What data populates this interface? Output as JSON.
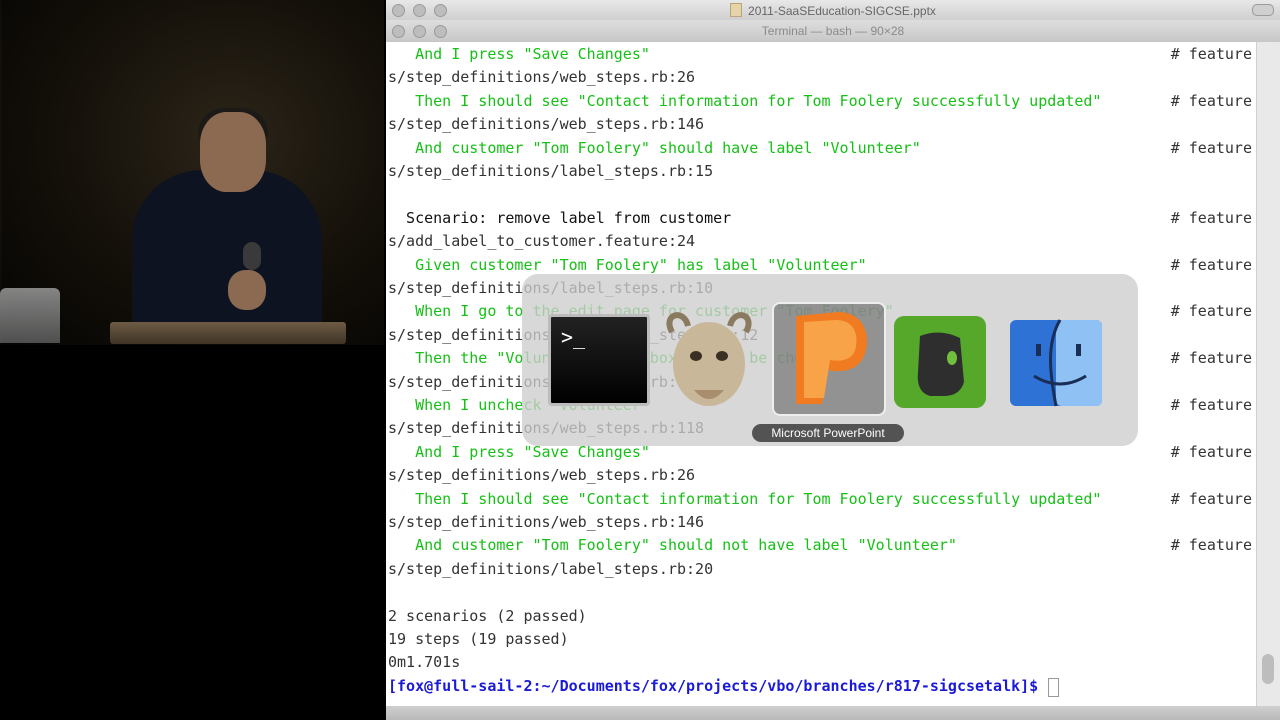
{
  "window": {
    "title": "2011-SaaSEducation-SIGCSE.pptx",
    "terminal_title": "Terminal — bash — 90×28"
  },
  "terminal_lines": [
    {
      "text": "   And I press \"Save Changes\"",
      "comment": "# feature",
      "style": "green"
    },
    {
      "text": "s/step_definitions/web_steps.rb:26",
      "comment": "",
      "style": "plain"
    },
    {
      "text": "   Then I should see \"Contact information for Tom Foolery successfully updated\"",
      "comment": "# feature",
      "style": "green"
    },
    {
      "text": "s/step_definitions/web_steps.rb:146",
      "comment": "",
      "style": "plain"
    },
    {
      "text": "   And customer \"Tom Foolery\" should have label \"Volunteer\"",
      "comment": "# feature",
      "style": "green"
    },
    {
      "text": "s/step_definitions/label_steps.rb:15",
      "comment": "",
      "style": "plain"
    },
    {
      "text": "",
      "comment": "",
      "style": "plain"
    },
    {
      "text": "  Scenario: remove label from customer",
      "comment": "# feature",
      "style": "black"
    },
    {
      "text": "s/add_label_to_customer.feature:24",
      "comment": "",
      "style": "plain"
    },
    {
      "text": "   Given customer \"Tom Foolery\" has label \"Volunteer\"",
      "comment": "# feature",
      "style": "green"
    },
    {
      "text": "s/step_definitions/label_steps.rb:10",
      "comment": "",
      "style": "plain"
    },
    {
      "text": "   When I go to the edit page for customer \"Tom Foolery\"",
      "comment": "# feature",
      "style": "green"
    },
    {
      "text": "s/step_definitions/navigation_steps.rb:12",
      "comment": "",
      "style": "plain"
    },
    {
      "text": "   Then the \"Volunteer\" checkbox should be checked",
      "comment": "# feature",
      "style": "green"
    },
    {
      "text": "s/step_definitions/web_steps.rb:181",
      "comment": "",
      "style": "plain"
    },
    {
      "text": "   When I uncheck \"Volunteer\"",
      "comment": "# feature",
      "style": "green"
    },
    {
      "text": "s/step_definitions/web_steps.rb:118",
      "comment": "",
      "style": "plain"
    },
    {
      "text": "   And I press \"Save Changes\"",
      "comment": "# feature",
      "style": "green"
    },
    {
      "text": "s/step_definitions/web_steps.rb:26",
      "comment": "",
      "style": "plain"
    },
    {
      "text": "   Then I should see \"Contact information for Tom Foolery successfully updated\"",
      "comment": "# feature",
      "style": "green"
    },
    {
      "text": "s/step_definitions/web_steps.rb:146",
      "comment": "",
      "style": "plain"
    },
    {
      "text": "   And customer \"Tom Foolery\" should not have label \"Volunteer\"",
      "comment": "# feature",
      "style": "green"
    },
    {
      "text": "s/step_definitions/label_steps.rb:20",
      "comment": "",
      "style": "plain"
    },
    {
      "text": "",
      "comment": "",
      "style": "plain"
    },
    {
      "text": "2 scenarios (2 passed)",
      "comment": "",
      "style": "plain"
    },
    {
      "text": "19 steps (19 passed)",
      "comment": "",
      "style": "plain"
    },
    {
      "text": "0m1.701s",
      "comment": "",
      "style": "plain"
    },
    {
      "text": "[fox@full-sail-2:~/Documents/fox/projects/vbo/branches/r817-sigcsetalk]$",
      "comment": "",
      "style": "prompt"
    }
  ],
  "app_switcher": {
    "selected_label": "Microsoft PowerPoint",
    "apps": [
      "terminal-icon",
      "gnu-emacs-icon",
      "powerpoint-icon",
      "evernote-icon",
      "finder-icon"
    ]
  },
  "colors": {
    "green": "#16c016",
    "prompt_blue": "#1a1ad8"
  }
}
